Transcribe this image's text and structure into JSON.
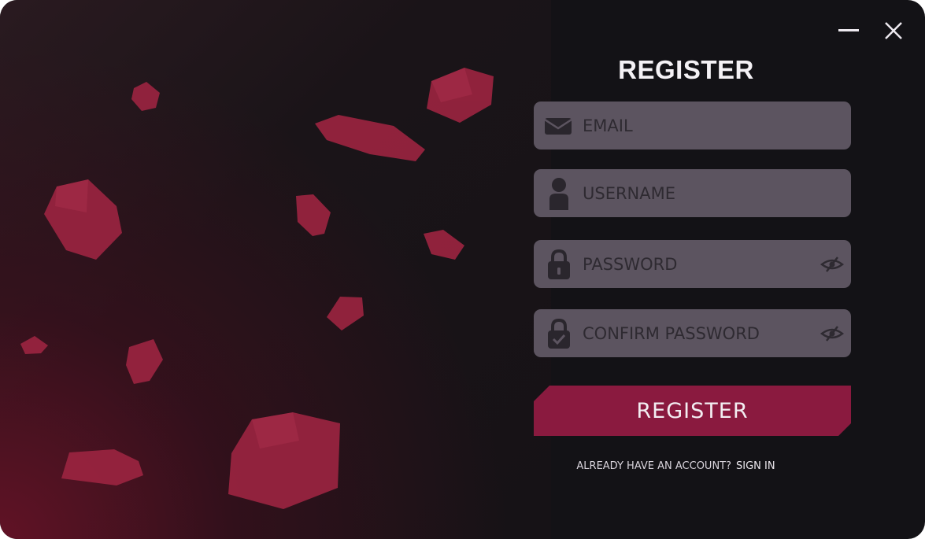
{
  "window": {
    "minimize_icon": "minimize-icon",
    "close_icon": "close-icon"
  },
  "form": {
    "title": "REGISTER",
    "email": {
      "placeholder": "EMAIL",
      "value": "",
      "icon": "envelope-icon"
    },
    "username": {
      "placeholder": "USERNAME",
      "value": "",
      "icon": "user-icon"
    },
    "password": {
      "placeholder": "PASSWORD",
      "value": "",
      "icon": "lock-icon",
      "toggle_icon": "eye-slash-icon"
    },
    "confirm_password": {
      "placeholder": "CONFIRM PASSWORD",
      "value": "",
      "icon": "lock-check-icon",
      "toggle_icon": "eye-slash-icon"
    },
    "submit_label": "REGISTER",
    "signin_prompt": "ALREADY HAVE AN ACCOUNT?",
    "signin_link": "SIGN IN"
  },
  "colors": {
    "window_bg": "#131216",
    "field_bg": "#5c5460",
    "accent": "#8a1a3f",
    "gem": "#9a2440",
    "text": "#f4f1f5"
  }
}
